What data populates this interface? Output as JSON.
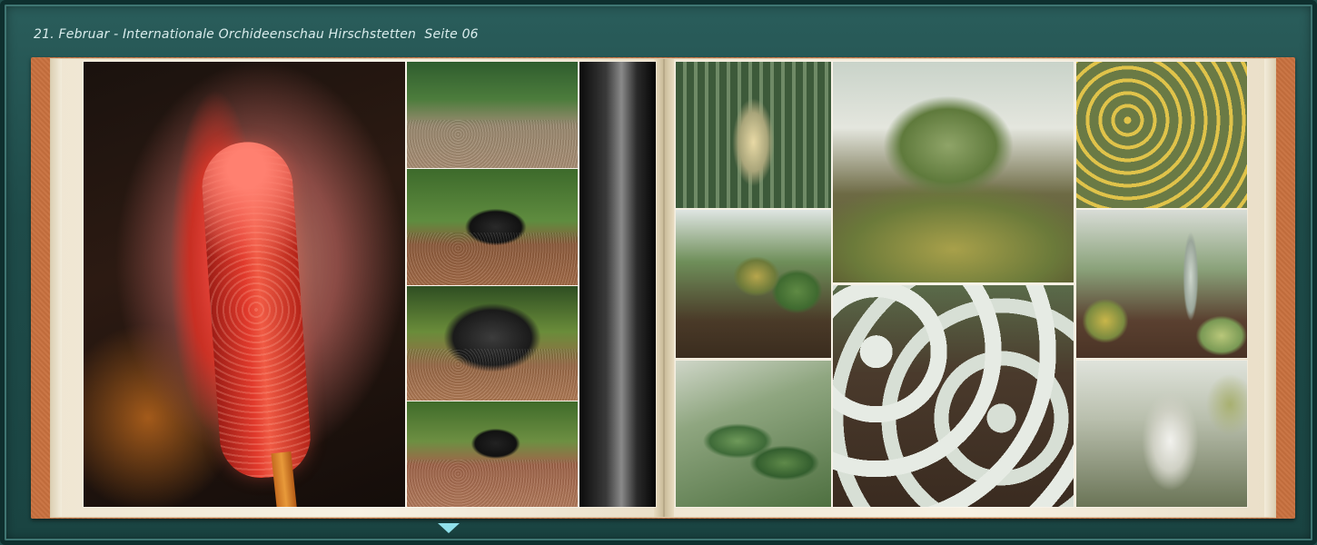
{
  "header": {
    "title": "21. Februar - Internationale Orchideenschau Hirschstetten  Seite 06"
  },
  "album": {
    "left_page": {
      "photos": [
        {
          "icon": "anthurium-photo"
        },
        {
          "icon": "ant-sculpture-display-photo"
        },
        {
          "icon": "ant-sculpture-photo"
        },
        {
          "icon": "ant-sculpture-closeup-photo"
        },
        {
          "icon": "ant-sculpture-front-photo"
        },
        {
          "icon": "blurred-photo"
        }
      ]
    },
    "right_page": {
      "photos": [
        {
          "icon": "cactus-bloom-photo"
        },
        {
          "icon": "golden-barrel-cactus-photo"
        },
        {
          "icon": "cactus-field-photo"
        },
        {
          "icon": "greenhouse-cacti-photo"
        },
        {
          "icon": "barrel-cacti-rows-photo"
        },
        {
          "icon": "cactus-pots-photo"
        },
        {
          "icon": "succulent-closeup-photo"
        },
        {
          "icon": "hairy-cactus-photo"
        }
      ]
    }
  },
  "navigation": {
    "next_icon": "triangle-down-icon"
  },
  "colors": {
    "frame": "#1f4d4b",
    "book_cover": "#c8703e",
    "page": "#f7f1e3",
    "title_text": "#d9ecec",
    "nav_arrow": "#8fe0ea"
  }
}
